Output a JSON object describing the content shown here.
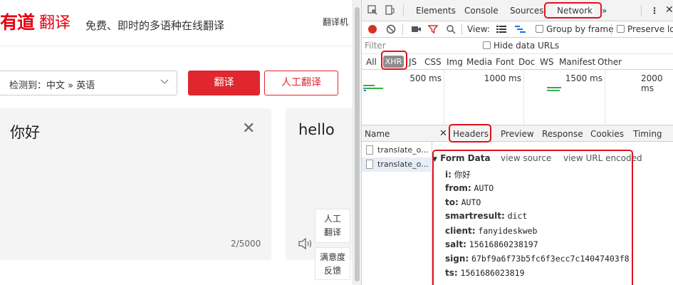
{
  "youdao": {
    "logo_text": "有道",
    "logo_tail": "翻译",
    "slogan": "免费、即时的多语种在线翻译",
    "machine_link": "翻译机",
    "lang_select": "检测到：中文 » 英语",
    "translate_button": "翻译",
    "human_translate_button": "人工翻译",
    "source_text": "你好",
    "char_count": "2/5000",
    "target_text": "hello",
    "side_buttons": [
      "人工\n翻译",
      "满意度\n反馈"
    ]
  },
  "devtools": {
    "tabs": [
      "Elements",
      "Console",
      "Sources",
      "Network"
    ],
    "active_tab": "Network",
    "more_tabs": "»",
    "toolbar": {
      "view_label": "View:",
      "group_by_frame": "Group by frame",
      "preserve_log": "Preserve log"
    },
    "filter_placeholder": "Filter",
    "hide_data_urls": "Hide data URLs",
    "type_filters": [
      "All",
      "XHR",
      "JS",
      "CSS",
      "Img",
      "Media",
      "Font",
      "Doc",
      "WS",
      "Manifest",
      "Other"
    ],
    "active_type": "XHR",
    "timeline_labels": [
      "500 ms",
      "1000 ms",
      "1500 ms",
      "2000 ms"
    ],
    "name_header": "Name",
    "requests": [
      "translate_o...",
      "translate_o..."
    ],
    "detail_tabs": [
      "Headers",
      "Preview",
      "Response",
      "Cookies",
      "Timing"
    ],
    "active_detail_tab": "Headers",
    "form_data": {
      "title": "Form Data",
      "view_source": "view source",
      "view_url_encoded": "view URL encoded",
      "fields": [
        {
          "key": "i:",
          "value": "你好"
        },
        {
          "key": "from:",
          "value": "AUTO"
        },
        {
          "key": "to:",
          "value": "AUTO"
        },
        {
          "key": "smartresult:",
          "value": "dict"
        },
        {
          "key": "client:",
          "value": "fanyideskweb"
        },
        {
          "key": "salt:",
          "value": "15616860238197"
        },
        {
          "key": "sign:",
          "value": "67bf9a6f73b5fc6f3ecc7c14047403f8"
        },
        {
          "key": "ts:",
          "value": "1561686023819"
        }
      ]
    },
    "highlight_color": "#e0121e"
  }
}
